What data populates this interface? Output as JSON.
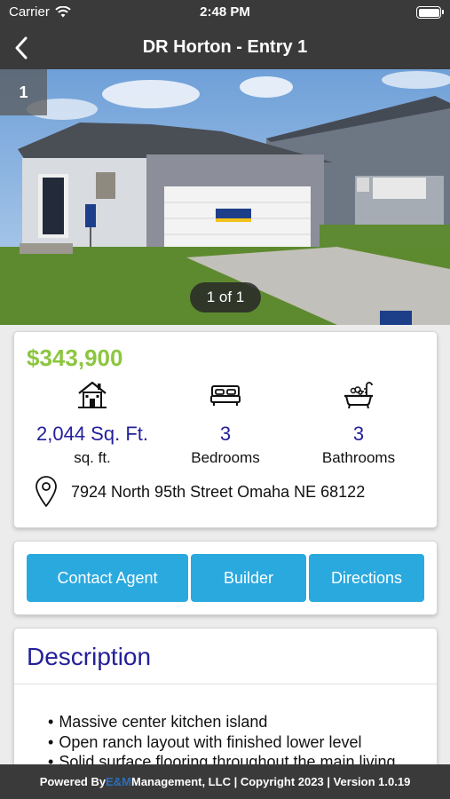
{
  "status_bar": {
    "carrier": "Carrier",
    "time": "2:48 PM"
  },
  "nav": {
    "title": "DR Horton - Entry 1"
  },
  "gallery": {
    "index_badge": "1",
    "counter": "1 of 1"
  },
  "listing": {
    "price": "$343,900",
    "square_feet": {
      "value": "2,044 Sq. Ft.",
      "label": "sq. ft.",
      "icon": "house-icon"
    },
    "bedrooms": {
      "value": "3",
      "label": "Bedrooms",
      "icon": "bed-icon"
    },
    "bathrooms": {
      "value": "3",
      "label": "Bathrooms",
      "icon": "bathtub-icon"
    },
    "address": "7924 North 95th Street Omaha NE 68122",
    "address_icon": "location-pin-icon"
  },
  "actions": {
    "contact_agent": "Contact Agent",
    "builder": "Builder",
    "directions": "Directions"
  },
  "description": {
    "title": "Description",
    "items": [
      "Massive center kitchen island",
      "Open ranch layout with finished lower level",
      "Solid surface flooring throughout the main living"
    ]
  },
  "footer": {
    "prefix": "Powered By ",
    "brand": "E&M",
    "suffix": " Management, LLC | Copyright 2023 | Version 1.0.19"
  },
  "colors": {
    "bar_background": "#3a3a3a",
    "price": "#8cc63f",
    "accent_text": "#24209a",
    "button": "#2aa9df"
  }
}
